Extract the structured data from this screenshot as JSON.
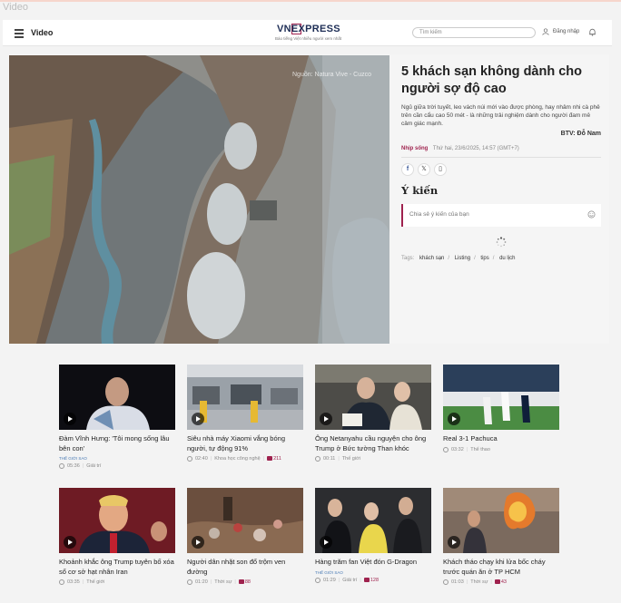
{
  "page_label": "Video",
  "header": {
    "section_title": "Video",
    "logo_text": "VNEXPRESS",
    "logo_tagline": "Báo tiếng Việt nhiều người xem nhất",
    "search_placeholder": "Tìm kiếm",
    "login_label": "Đăng nhập"
  },
  "hero": {
    "video_source": "Nguồn: Natura Vive - Cuzco",
    "title": "5 khách sạn không dành cho người sợ độ cao",
    "description": "Ngủ giữa trời tuyết, leo vách núi mới vào được phòng, hay nhâm nhi cà phê trên cần cẩu cao 50 mét - là những trải nghiệm dành cho người đam mê cảm giác mạnh.",
    "author": "BTV: Đỗ Nam",
    "category": "Nhịp sống",
    "timestamp": "Thứ hai, 23/6/2025, 14:57 (GMT+7)",
    "comments_title": "Ý kiến",
    "comment_placeholder": "Chia sẻ ý kiến của bạn",
    "tags_label": "Tags:",
    "tags": [
      "khách sạn",
      "Listing",
      "tips",
      "du lịch"
    ]
  },
  "cards": [
    {
      "title": "Đàm Vĩnh Hưng: 'Tôi mong sống lâu bên con'",
      "badge": "Thế giới sao",
      "duration": "05:36",
      "category": "Giải trí",
      "comments": ""
    },
    {
      "title": "Siêu nhà máy Xiaomi vắng bóng người, tự động 91%",
      "badge": "",
      "duration": "02:40",
      "category": "Khoa học công nghệ",
      "comments": "211"
    },
    {
      "title": "Ông Netanyahu cầu nguyện cho ông Trump ở Bức tường Than khóc",
      "badge": "",
      "duration": "00:11",
      "category": "Thế giới",
      "comments": ""
    },
    {
      "title": "Real 3-1 Pachuca",
      "badge": "",
      "duration": "03:32",
      "category": "Thể thao",
      "comments": ""
    },
    {
      "title": "Khoảnh khắc ông Trump tuyên bố xóa sổ cơ sở hạt nhân Iran",
      "badge": "",
      "duration": "03:35",
      "category": "Thế giới",
      "comments": ""
    },
    {
      "title": "Người dân nhặt son đổ trộm ven đường",
      "badge": "",
      "duration": "01:20",
      "category": "Thời sự",
      "comments": "88"
    },
    {
      "title": "Hàng trăm fan Việt đón G-Dragon",
      "badge": "Thế giới sao",
      "duration": "01:29",
      "category": "Giải trí",
      "comments": "128"
    },
    {
      "title": "Khách tháo chạy khi lửa bốc cháy trước quán ăn ở TP HCM",
      "badge": "",
      "duration": "01:03",
      "category": "Thời sự",
      "comments": "43"
    }
  ],
  "colors": {
    "brand": "#9f224e",
    "badge": "#4a7bb5"
  }
}
